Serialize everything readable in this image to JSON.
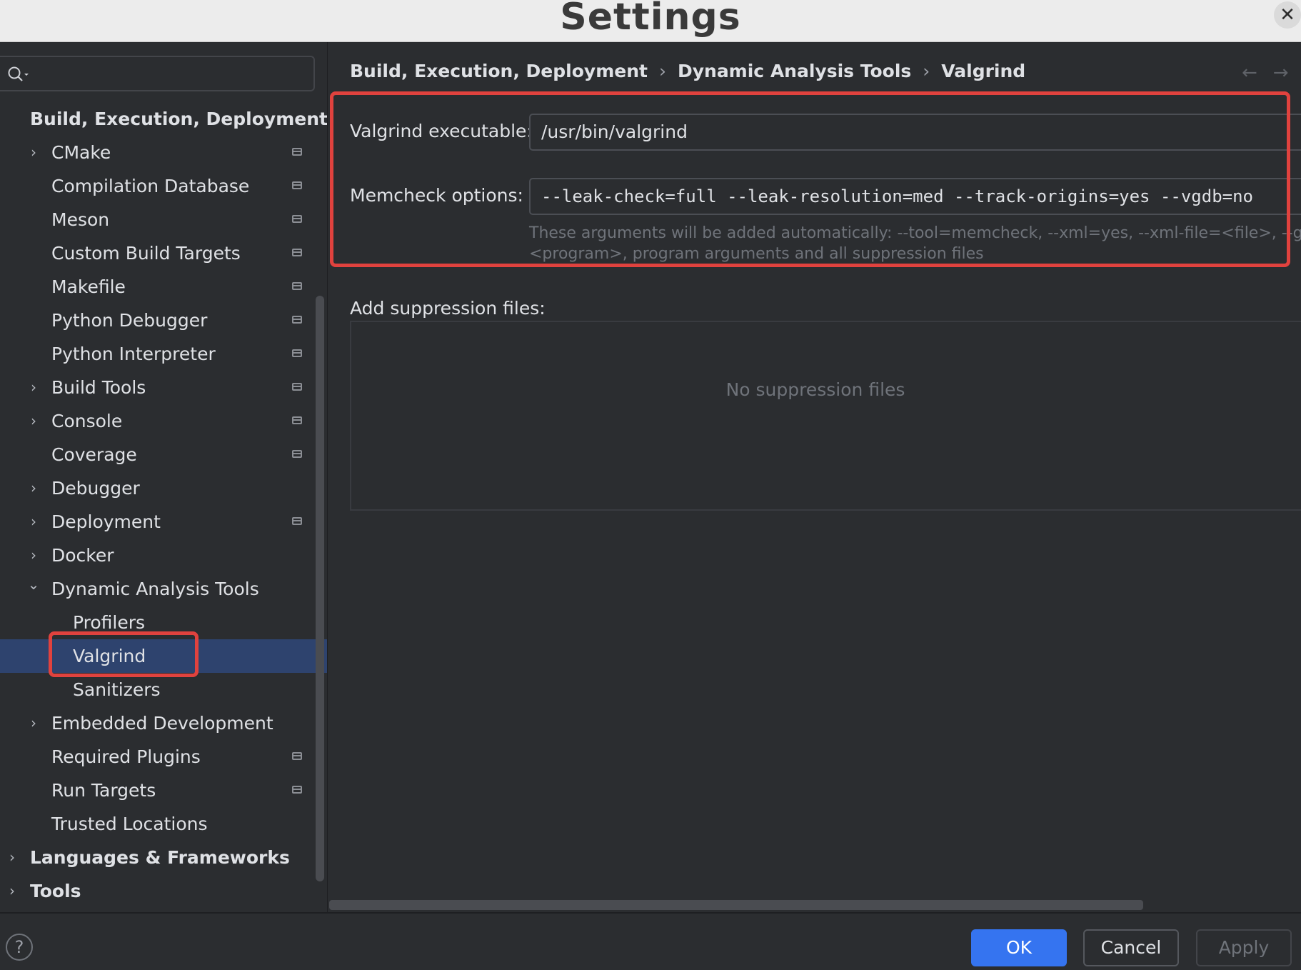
{
  "window": {
    "title": "Settings",
    "close_icon": "close-icon"
  },
  "search": {
    "value": "",
    "icon": "search-icon"
  },
  "tree": [
    {
      "label": "Build, Execution, Deployment",
      "level": 0,
      "chevron": "",
      "pin": false,
      "bold": true
    },
    {
      "label": "CMake",
      "level": 1,
      "chevron": "right",
      "pin": true
    },
    {
      "label": "Compilation Database",
      "level": 1,
      "chevron": "",
      "pin": true
    },
    {
      "label": "Meson",
      "level": 1,
      "chevron": "",
      "pin": true
    },
    {
      "label": "Custom Build Targets",
      "level": 1,
      "chevron": "",
      "pin": true
    },
    {
      "label": "Makefile",
      "level": 1,
      "chevron": "",
      "pin": true
    },
    {
      "label": "Python Debugger",
      "level": 1,
      "chevron": "",
      "pin": true
    },
    {
      "label": "Python Interpreter",
      "level": 1,
      "chevron": "",
      "pin": true
    },
    {
      "label": "Build Tools",
      "level": 1,
      "chevron": "right",
      "pin": true
    },
    {
      "label": "Console",
      "level": 1,
      "chevron": "right",
      "pin": true
    },
    {
      "label": "Coverage",
      "level": 1,
      "chevron": "",
      "pin": true
    },
    {
      "label": "Debugger",
      "level": 1,
      "chevron": "right",
      "pin": false
    },
    {
      "label": "Deployment",
      "level": 1,
      "chevron": "right",
      "pin": true
    },
    {
      "label": "Docker",
      "level": 1,
      "chevron": "right",
      "pin": false
    },
    {
      "label": "Dynamic Analysis Tools",
      "level": 1,
      "chevron": "down",
      "pin": false
    },
    {
      "label": "Profilers",
      "level": 2,
      "chevron": "",
      "pin": false
    },
    {
      "label": "Valgrind",
      "level": 2,
      "chevron": "",
      "pin": false,
      "selected": true
    },
    {
      "label": "Sanitizers",
      "level": 2,
      "chevron": "",
      "pin": false
    },
    {
      "label": "Embedded Development",
      "level": 1,
      "chevron": "right",
      "pin": false
    },
    {
      "label": "Required Plugins",
      "level": 1,
      "chevron": "",
      "pin": true
    },
    {
      "label": "Run Targets",
      "level": 1,
      "chevron": "",
      "pin": true
    },
    {
      "label": "Trusted Locations",
      "level": 1,
      "chevron": "",
      "pin": false
    },
    {
      "label": "Languages & Frameworks",
      "level": 0,
      "chevron": "right",
      "pin": false,
      "bold": true
    },
    {
      "label": "Tools",
      "level": 0,
      "chevron": "right",
      "pin": false,
      "bold": true
    }
  ],
  "breadcrumb": [
    "Build, Execution, Deployment",
    "Dynamic Analysis Tools",
    "Valgrind"
  ],
  "nav": {
    "back": "←",
    "forward": "→"
  },
  "valgrind": {
    "executable_label": "Valgrind executable:",
    "executable_value": "/usr/bin/valgrind",
    "memcheck_label": "Memcheck options:",
    "memcheck_value": "--leak-check=full --leak-resolution=med --track-origins=yes --vgdb=no",
    "hint_line1": "These arguments will be added automatically: --tool=memcheck, --xml=yes, --xml-file=<file>, --gen-s",
    "hint_line2": "<program>, program arguments and all suppression files"
  },
  "suppression": {
    "label": "Add suppression files:",
    "empty_text": "No suppression files"
  },
  "footer": {
    "help": "?",
    "ok": "OK",
    "cancel": "Cancel",
    "apply": "Apply"
  },
  "colors": {
    "accent": "#3574f0",
    "selection": "#2e436e",
    "highlight": "#e0423e",
    "background": "#2b2d30"
  }
}
